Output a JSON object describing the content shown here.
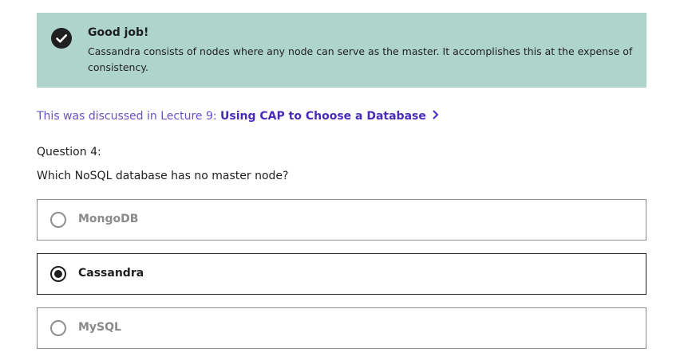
{
  "feedback": {
    "status_icon": "check-circle-icon",
    "title": "Good job!",
    "message": "Cassandra consists of nodes where any node can serve as the master. It accomplishes this at the expense of consistency.",
    "background_color": "#aed4cb"
  },
  "lecture_reference": {
    "prefix": "This was discussed in Lecture 9: ",
    "link_text": "Using CAP to Choose a Database",
    "icon": "chevron-right-icon",
    "link_color": "#4a2bb8"
  },
  "question": {
    "number_label": "Question 4:",
    "text": "Which NoSQL database has no master node?"
  },
  "options": [
    {
      "label": "MongoDB",
      "selected": false
    },
    {
      "label": "Cassandra",
      "selected": true
    },
    {
      "label": "MySQL",
      "selected": false
    }
  ]
}
